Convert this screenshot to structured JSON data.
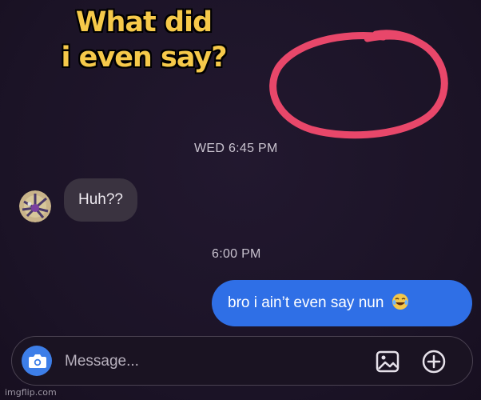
{
  "meme": {
    "caption_line1": "What did",
    "caption_line2": "i even say?"
  },
  "conversation": {
    "timestamps": [
      "WED 6:45 PM",
      "6:00 PM"
    ],
    "incoming_message": "Huh??",
    "outgoing_message": "bro i ain’t even say nun",
    "outgoing_emoji": "crying-laughing-emoji"
  },
  "composer": {
    "placeholder": "Message..."
  },
  "icons": {
    "camera": "camera-icon",
    "gallery": "image-gallery-icon",
    "add": "plus-circle-icon"
  },
  "colors": {
    "background": "#1c1428",
    "incoming_bubble": "#3a3340",
    "outgoing_bubble": "#2f6fe6",
    "camera_button": "#3d7ee8",
    "caption": "#f6c94a",
    "scribble": "#e8476a"
  },
  "watermark": "imgflip.com"
}
